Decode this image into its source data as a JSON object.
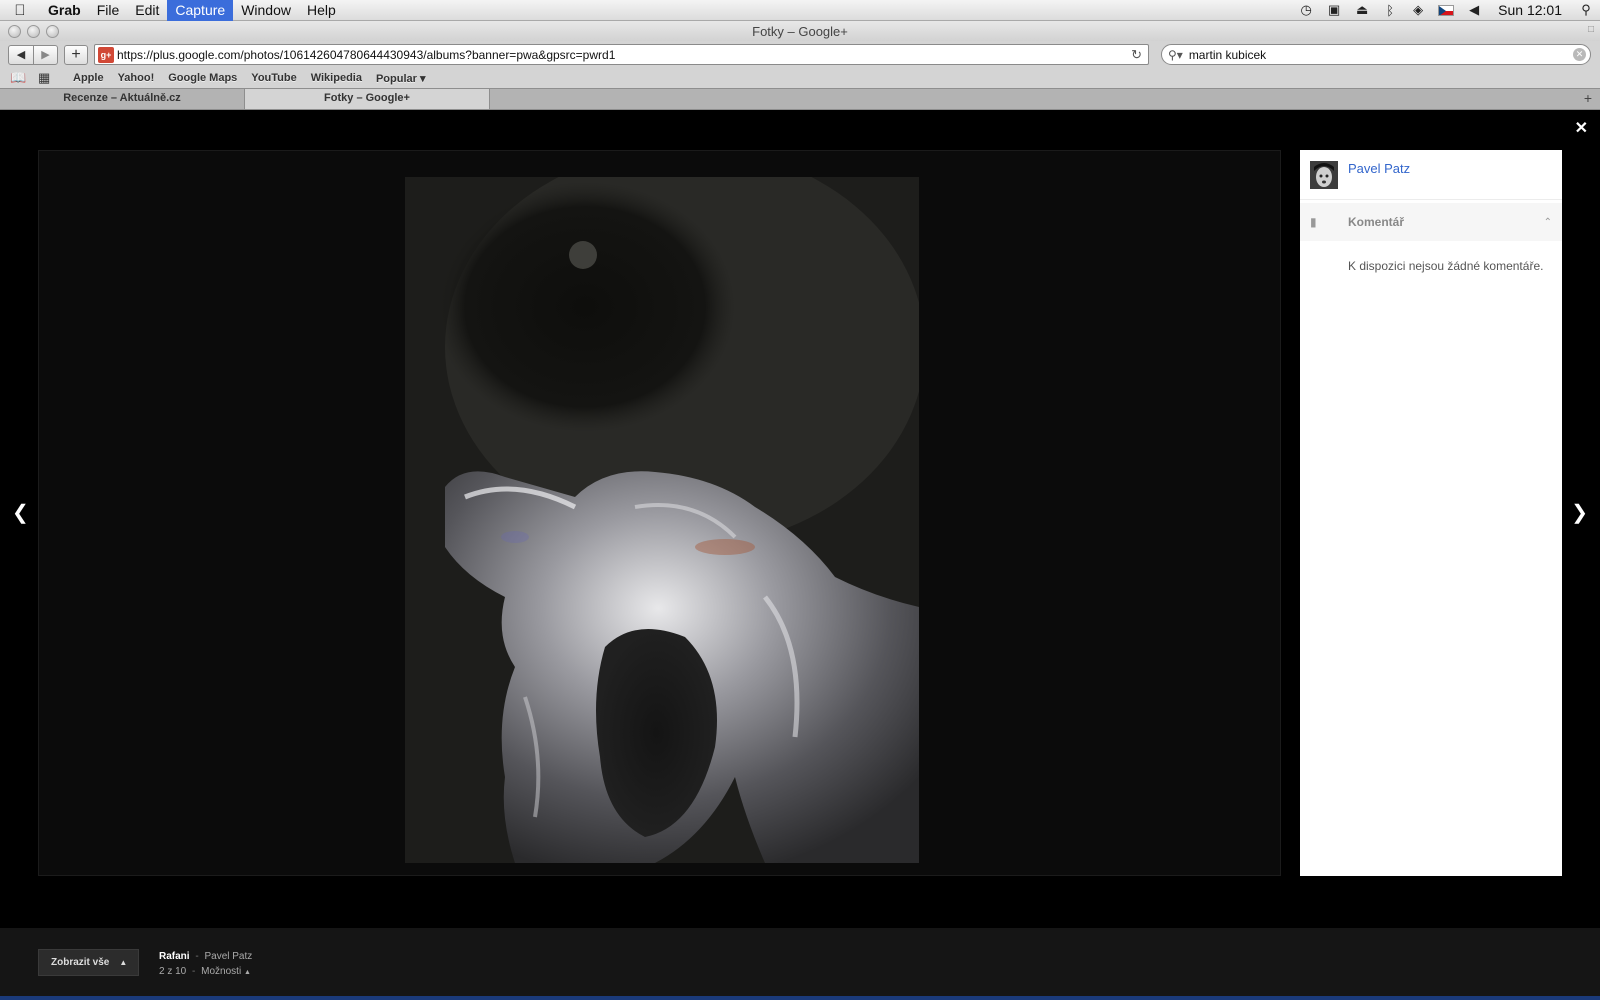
{
  "menubar": {
    "app_name": "Grab",
    "items": [
      "File",
      "Edit",
      "Capture",
      "Window",
      "Help"
    ],
    "active_item": "Capture",
    "clock": "Sun 12:01",
    "status_icons": [
      "time-machine-icon",
      "display-icon",
      "eject-icon",
      "bluetooth-icon",
      "wifi-icon",
      "flag-cz-icon",
      "volume-icon",
      "spotlight-icon"
    ]
  },
  "window": {
    "title": "Fotky – Google+"
  },
  "toolbar": {
    "back_glyph": "◀",
    "forward_glyph": "▶",
    "add_glyph": "+",
    "url": "https://plus.google.com/photos/106142604780644430943/albums?banner=pwa&gpsrc=pwrd1",
    "favicon_text": "g+",
    "search_value": "martin kubicek"
  },
  "bookmarks": {
    "items": [
      "Apple",
      "Yahoo!",
      "Google Maps",
      "YouTube",
      "Wikipedia",
      "Popular ▾"
    ]
  },
  "tabs": [
    {
      "label": "Recenze – Aktuálně.cz",
      "active": false
    },
    {
      "label": "Fotky – Google+",
      "active": true
    }
  ],
  "lightbox": {
    "close_glyph": "✕",
    "prev_glyph": "❮",
    "next_glyph": "❯"
  },
  "panel": {
    "author": "Pavel Patz",
    "comments_label": "Komentář",
    "no_comments": "K dispozici nejsou žádné komentáře."
  },
  "footer": {
    "show_all": "Zobrazit vše",
    "album": "Rafani",
    "separator": "-",
    "owner": "Pavel Patz",
    "counter": "2 z 10",
    "options": "Možnosti"
  },
  "colors": {
    "link": "#3366cc",
    "menu_active": "#3b6ddb",
    "lightbox_bg": "#000000"
  }
}
